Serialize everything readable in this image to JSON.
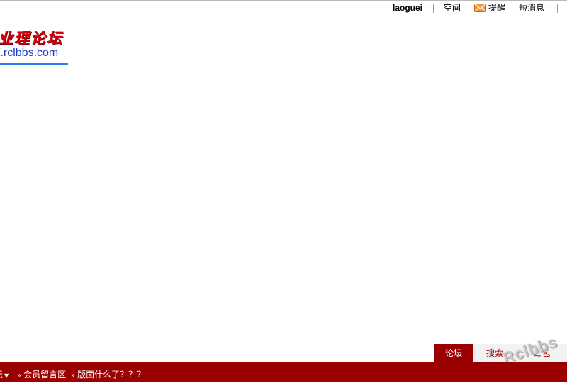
{
  "userbar": {
    "username": "laoguei",
    "separator": "|",
    "space_link": "空间",
    "notify_link": "提醒",
    "pm_link": "短消息"
  },
  "logo": {
    "cn_text": "业理论坛",
    "url_text": "/.rclbbs.com"
  },
  "tabs": {
    "forum": "论坛",
    "search": "搜索",
    "redpack": "红包"
  },
  "watermark": "Rclbbs",
  "breadcrumb": {
    "first": "坛",
    "arrow": "»",
    "board": "会员留言区",
    "thread": "版面什么了？？？"
  },
  "colors": {
    "brand_red": "#9b0000",
    "logo_red": "#d4000e",
    "logo_blue": "#1d3ec3"
  }
}
